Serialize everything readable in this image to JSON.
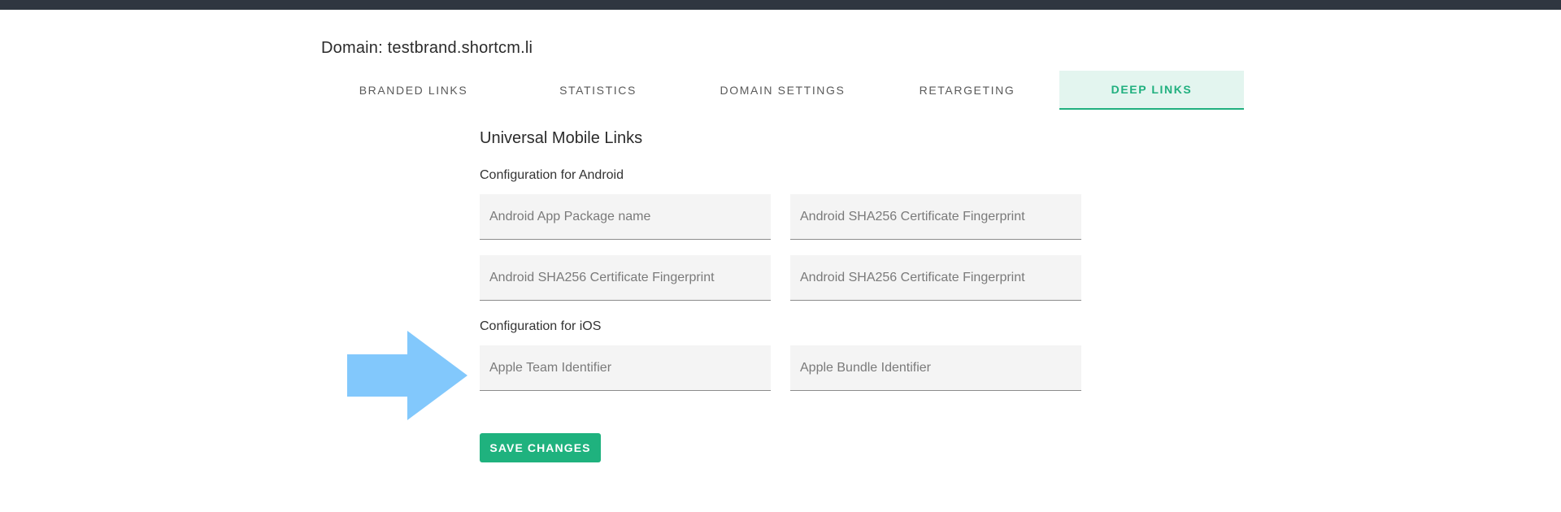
{
  "domain": {
    "title": "Domain: testbrand.shortcm.li"
  },
  "tabs": [
    {
      "label": "BRANDED LINKS",
      "active": false
    },
    {
      "label": "STATISTICS",
      "active": false
    },
    {
      "label": "DOMAIN SETTINGS",
      "active": false
    },
    {
      "label": "RETARGETING",
      "active": false
    },
    {
      "label": "DEEP LINKS",
      "active": true
    }
  ],
  "section": {
    "title": "Universal Mobile Links",
    "android_label": "Configuration for Android",
    "ios_label": "Configuration for iOS"
  },
  "fields": {
    "android_package": {
      "placeholder": "Android App Package name",
      "value": ""
    },
    "android_fp_1": {
      "placeholder": "Android SHA256 Certificate Fingerprint",
      "value": ""
    },
    "android_fp_2": {
      "placeholder": "Android SHA256 Certificate Fingerprint",
      "value": ""
    },
    "android_fp_3": {
      "placeholder": "Android SHA256 Certificate Fingerprint",
      "value": ""
    },
    "apple_team": {
      "placeholder": "Apple Team Identifier",
      "value": ""
    },
    "apple_bundle": {
      "placeholder": "Apple Bundle Identifier",
      "value": ""
    }
  },
  "actions": {
    "save_label": "SAVE CHANGES"
  },
  "annotation": {
    "icon": "right-arrow-icon",
    "color": "#82c8fc"
  },
  "colors": {
    "accent": "#1fb27e",
    "active_tab_bg": "#e3f5ef",
    "topbar": "#2f3640"
  }
}
